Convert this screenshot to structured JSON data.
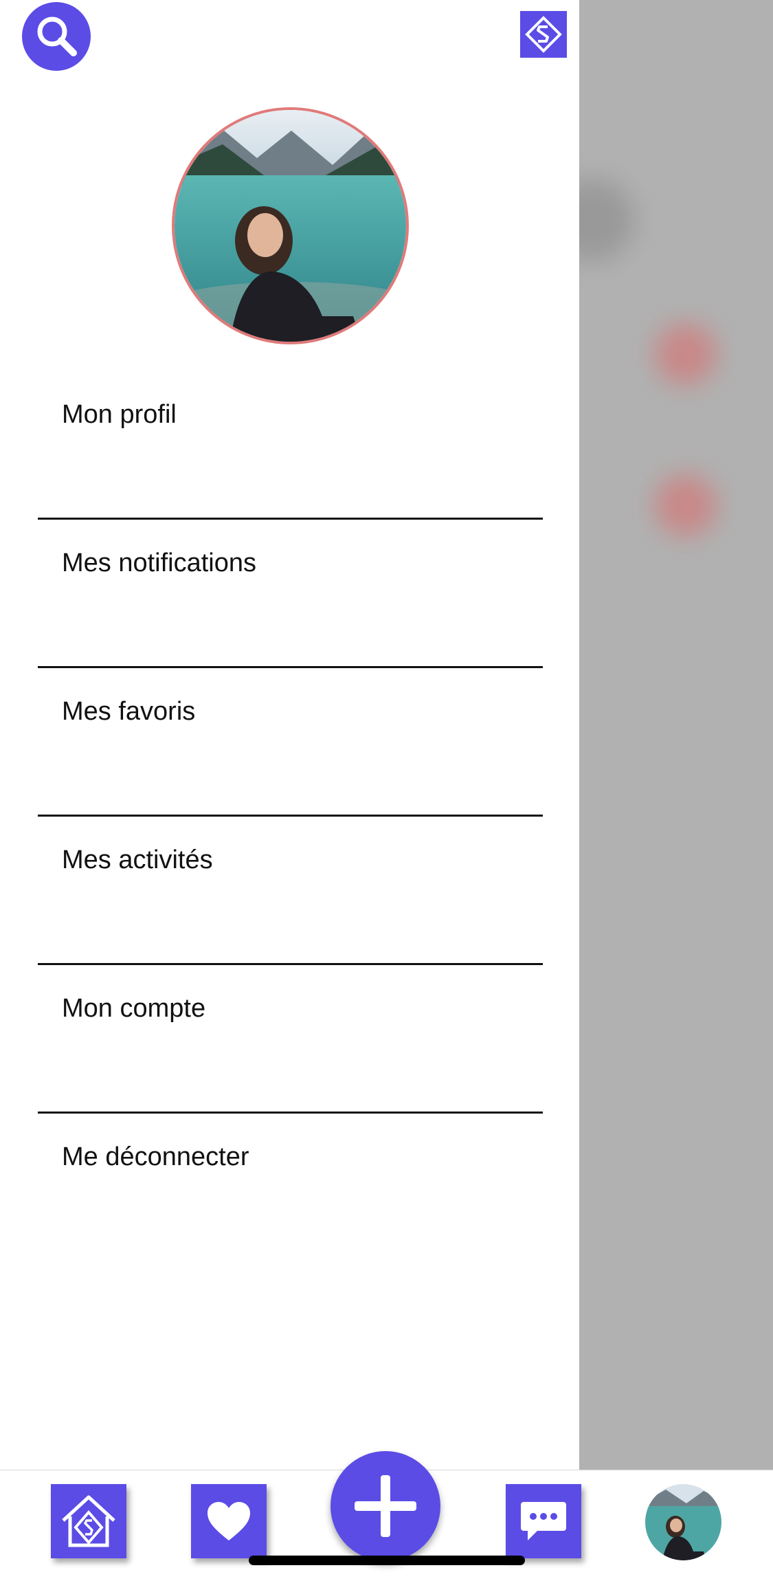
{
  "colors": {
    "accent": "#5b4ce6",
    "avatar_border": "#e07a7a",
    "overlay": "#b1b1b1",
    "divider": "#111111"
  },
  "header": {
    "search_icon": "search-icon",
    "logo_icon": "app-logo-icon"
  },
  "menu": {
    "items": [
      {
        "label": "Mon profil"
      },
      {
        "label": "Mes notifications"
      },
      {
        "label": "Mes favoris"
      },
      {
        "label": "Mes activités"
      },
      {
        "label": "Mon compte"
      },
      {
        "label": "Me déconnecter"
      }
    ]
  },
  "tabbar": {
    "icons": [
      "home-icon",
      "heart-icon",
      "plus-icon",
      "chat-icon",
      "profile-avatar"
    ]
  }
}
